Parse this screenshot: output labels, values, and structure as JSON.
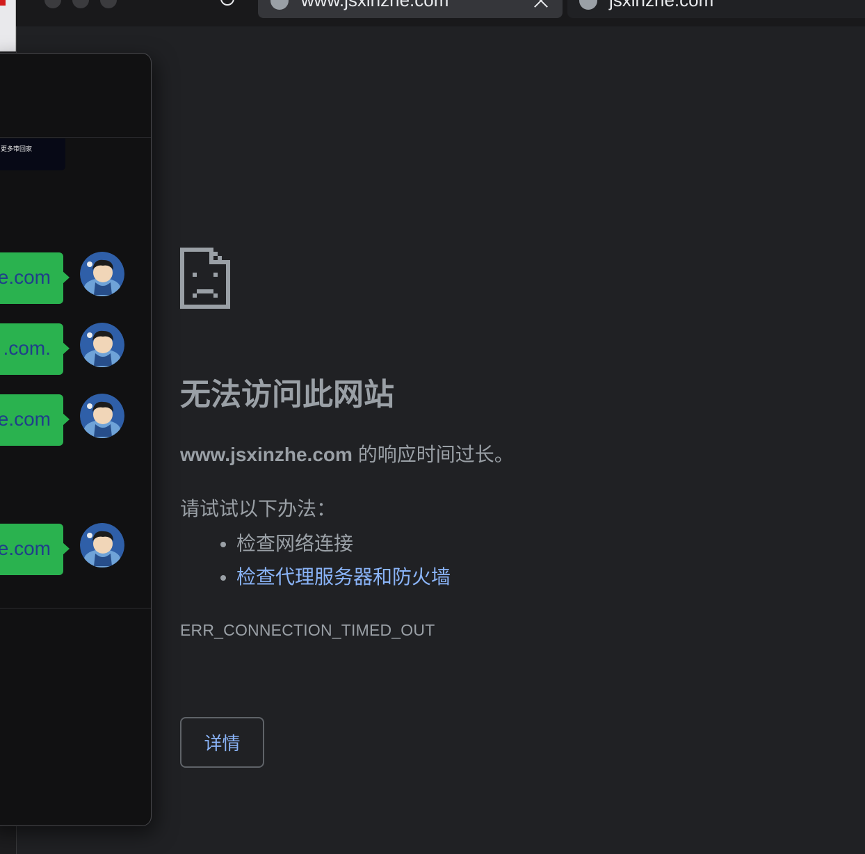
{
  "browser": {
    "tabs": [
      {
        "title": "www.jsxinzhe.com",
        "active": true
      },
      {
        "title": "jsxinzhe.com",
        "active": false
      }
    ]
  },
  "chat_window": {
    "banner_text": "更多带回家",
    "messages": [
      {
        "text": "e.com"
      },
      {
        "text": ".com."
      },
      {
        "text": "e.com"
      },
      {
        "text": "e.com"
      }
    ],
    "bubble_color": "#2ab24f"
  },
  "error_page": {
    "icon": "sad-page-icon",
    "heading": "无法访问此网站",
    "host": "www.jsxinzhe.com",
    "host_suffix": " 的响应时间过长。",
    "suggest_title": "请试试以下办法：",
    "suggestions": [
      {
        "text": "检查网络连接",
        "is_link": false
      },
      {
        "text": "检查代理服务器和防火墙",
        "is_link": true
      }
    ],
    "error_code": "ERR_CONNECTION_TIMED_OUT",
    "details_button": "详情",
    "link_color": "#8ab4f8",
    "background": "#202124"
  }
}
